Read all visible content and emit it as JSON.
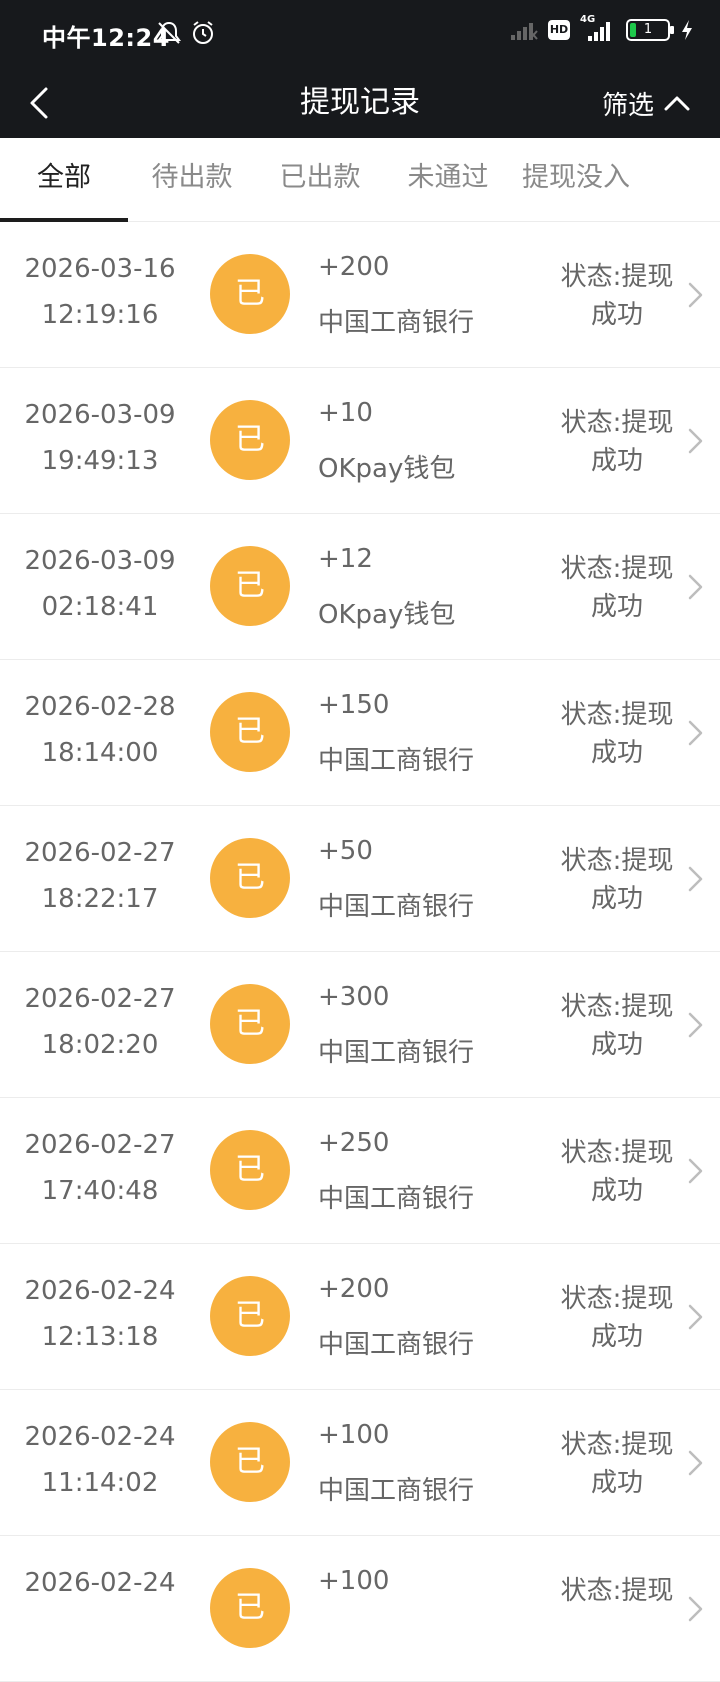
{
  "status_bar": {
    "time": "中午12:24",
    "icons": [
      "mute-icon",
      "alarm-icon",
      "signal-weak-icon",
      "hd-icon",
      "signal-4g-icon",
      "battery-icon",
      "charging-icon"
    ],
    "network_label": "4G",
    "hd_label": "HD",
    "battery_level": "1"
  },
  "nav": {
    "title": "提现记录",
    "filter_label": "筛选"
  },
  "tabs": [
    {
      "label": "全部",
      "active": true
    },
    {
      "label": "待出款",
      "active": false
    },
    {
      "label": "已出款",
      "active": false
    },
    {
      "label": "未通过",
      "active": false
    },
    {
      "label": "提现没入",
      "active": false
    }
  ],
  "records": [
    {
      "date": "2026-03-16",
      "time": "12:19:16",
      "badge": "已",
      "amount": "+200",
      "channel": "中国工商银行",
      "status_line1": "状态:提现",
      "status_line2": "成功"
    },
    {
      "date": "2026-03-09",
      "time": "19:49:13",
      "badge": "已",
      "amount": "+10",
      "channel": "OKpay钱包",
      "status_line1": "状态:提现",
      "status_line2": "成功"
    },
    {
      "date": "2026-03-09",
      "time": "02:18:41",
      "badge": "已",
      "amount": "+12",
      "channel": "OKpay钱包",
      "status_line1": "状态:提现",
      "status_line2": "成功"
    },
    {
      "date": "2026-02-28",
      "time": "18:14:00",
      "badge": "已",
      "amount": "+150",
      "channel": "中国工商银行",
      "status_line1": "状态:提现",
      "status_line2": "成功"
    },
    {
      "date": "2026-02-27",
      "time": "18:22:17",
      "badge": "已",
      "amount": "+50",
      "channel": "中国工商银行",
      "status_line1": "状态:提现",
      "status_line2": "成功"
    },
    {
      "date": "2026-02-27",
      "time": "18:02:20",
      "badge": "已",
      "amount": "+300",
      "channel": "中国工商银行",
      "status_line1": "状态:提现",
      "status_line2": "成功"
    },
    {
      "date": "2026-02-27",
      "time": "17:40:48",
      "badge": "已",
      "amount": "+250",
      "channel": "中国工商银行",
      "status_line1": "状态:提现",
      "status_line2": "成功"
    },
    {
      "date": "2026-02-24",
      "time": "12:13:18",
      "badge": "已",
      "amount": "+200",
      "channel": "中国工商银行",
      "status_line1": "状态:提现",
      "status_line2": "成功"
    },
    {
      "date": "2026-02-24",
      "time": "11:14:02",
      "badge": "已",
      "amount": "+100",
      "channel": "中国工商银行",
      "status_line1": "状态:提现",
      "status_line2": "成功"
    },
    {
      "date": "2026-02-24",
      "time": "",
      "badge": "已",
      "amount": "+100",
      "channel": "",
      "status_line1": "状态:提现",
      "status_line2": ""
    }
  ]
}
